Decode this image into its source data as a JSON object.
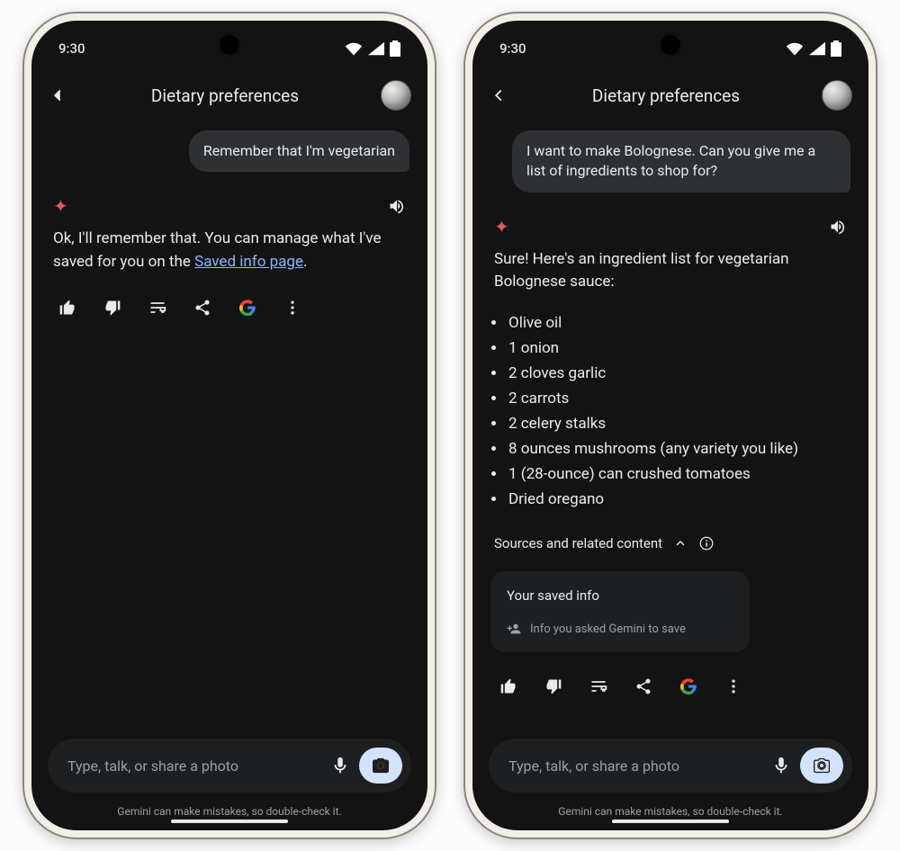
{
  "status": {
    "time": "9:30"
  },
  "left": {
    "title": "Dietary preferences",
    "user_message": "Remember that I'm vegetarian",
    "assistant_prefix": "Ok, I'll remember that. You can manage what I've saved for you on the ",
    "assistant_link_text": "Saved info page",
    "assistant_suffix": ".",
    "composer_placeholder": "Type, talk, or share a photo",
    "footnote": "Gemini can make mistakes, so double-check it."
  },
  "right": {
    "title": "Dietary preferences",
    "user_message": "I want to make Bolognese. Can you give me a list of ingredients to shop for?",
    "assistant_intro": "Sure! Here's an ingredient list for vegetarian Bolognese sauce:",
    "ingredients": [
      "Olive oil",
      "1 onion",
      "2 cloves garlic",
      "2 carrots",
      "2 celery stalks",
      "8 ounces mushrooms (any variety you like)",
      "1 (28-ounce) can crushed tomatoes",
      "Dried oregano"
    ],
    "sources_label": "Sources and related content",
    "saved_card_title": "Your saved info",
    "saved_card_sub": "Info you asked Gemini to save",
    "composer_placeholder": "Type, talk, or share a photo",
    "footnote": "Gemini can make mistakes, so double-check it."
  }
}
